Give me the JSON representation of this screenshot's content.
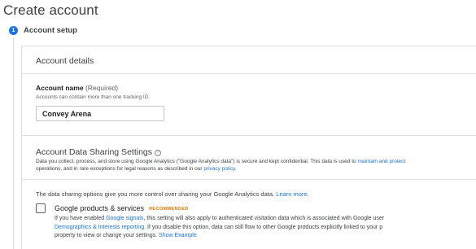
{
  "page": {
    "title": "Create account"
  },
  "stepper": {
    "step_number": "1",
    "step_label": "Account setup"
  },
  "account_details": {
    "title": "Account details",
    "name_label": "Account name",
    "name_required": "(Required)",
    "name_hint": "Accounts can contain more than one tracking ID.",
    "name_value": "Convey Arena"
  },
  "data_sharing": {
    "title": "Account Data Sharing Settings",
    "help_glyph": "?",
    "desc_line1_prefix": "Data you collect, process, and store using Google Analytics (\"Google Analytics data\") is secure and kept confidential. This data is used to",
    "desc_line1_link": "maintain and protect",
    "desc_line2_prefix": "operations, and in rare exceptions for legal reasons as described in our",
    "desc_line2_link": "privacy policy",
    "desc_line2_suffix": ".",
    "intro_text": "The data sharing options give you more control over sharing your Google Analytics data.",
    "intro_link": "Learn more.",
    "option": {
      "title": "Google products & services",
      "badge": "RECOMMENDED",
      "line1_prefix": "If you have enabled",
      "line1_link": "Google signals",
      "line1_suffix": ", this setting will also apply to authenticated visitation data which is associated with Google user",
      "line2_link": "Demographics & Interests reporting",
      "line2_suffix": ". If you disable this option, data can still flow to other Google products explicitly linked to your p",
      "line3_prefix": "property to view or change your settings.",
      "line3_link": "Show Example",
      "checked": false
    }
  },
  "colors": {
    "accent": "#1a73e8",
    "badge": "#e37400",
    "text": "#202124"
  }
}
